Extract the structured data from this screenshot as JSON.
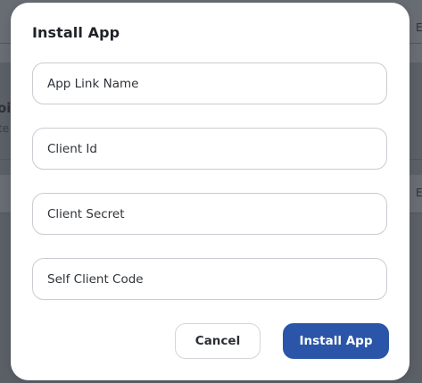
{
  "modal": {
    "title": "Install App",
    "fields": [
      {
        "placeholder": "App Link Name",
        "value": ""
      },
      {
        "placeholder": "Client Id",
        "value": ""
      },
      {
        "placeholder": "Client Secret",
        "value": ""
      },
      {
        "placeholder": "Self Client Code",
        "value": ""
      }
    ],
    "cancel_label": "Cancel",
    "install_label": "Install App"
  },
  "background": {
    "fragments": [
      "E",
      "oi",
      "te",
      "E"
    ]
  },
  "colors": {
    "overlay": "#5b5f66",
    "primary": "#2b55a8",
    "modal_bg": "#ffffff",
    "field_border": "#c9ccd1"
  }
}
